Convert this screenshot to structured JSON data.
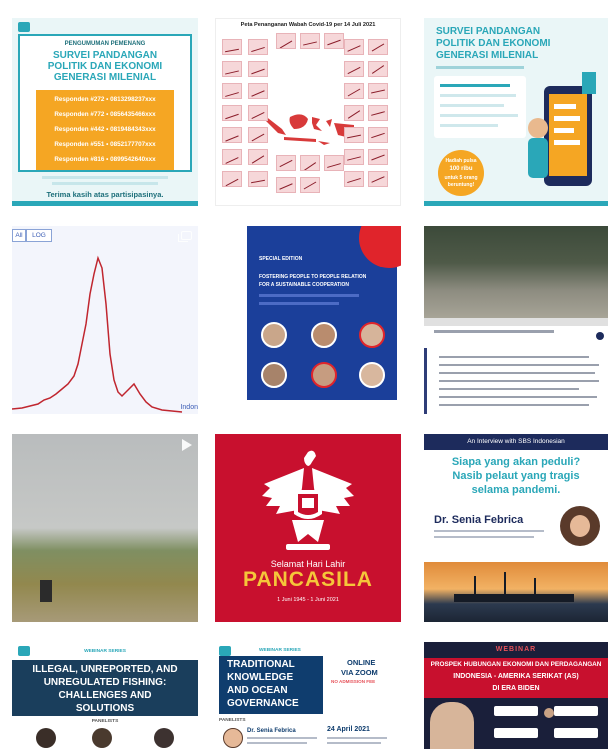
{
  "colors": {
    "teal": "#2aa7b8",
    "orange": "#f5a623",
    "navy": "#1d2b5c",
    "red": "#c8102e",
    "darkblue": "#0f3d6e",
    "blue": "#1b3f9a"
  },
  "tiles": {
    "survey_winners": {
      "heading": "PENGUMUMAN PEMENANG",
      "title": [
        "SURVEI PANDANGAN",
        "POLITIK DAN EKONOMI",
        "GENERASI MILENIAL"
      ],
      "responders": [
        "Responden #272 • 0813298237xxx",
        "Responden #772 • 0856435466xxx",
        "Responden #442 • 0819484343xxx",
        "Responden #551 • 0852177707xxx",
        "Responden #816 • 0899542640xxx"
      ],
      "thanks": "Terima kasih atas partisipasinya."
    },
    "covid_map": {
      "title": "Peta Penanganan Wabah Covid-19 per 14 Juli 2021"
    },
    "survey_invite": {
      "title": [
        "SURVEI PANDANGAN",
        "POLITIK DAN EKONOMI",
        "GENERASI MILENIAL"
      ],
      "badge": [
        "Hadiah pulsa",
        "100 ribu",
        "untuk 5 orang",
        "beruntung!"
      ]
    },
    "log_chart": {
      "toggle_left": "All",
      "toggle_right": "LOG",
      "legend": "Indon"
    },
    "special_edition": {
      "lines": [
        "SPECIAL EDITION",
        "FOSTERING PEOPLE TO PEOPLE RELATION",
        "FOR A SUSTAINABLE COOPERATION"
      ]
    },
    "pancasila": {
      "subtitle": "Selamat Hari Lahir",
      "title": "PANCASILA",
      "date": "1 Juni 1945 - 1 Juni 2021"
    },
    "seafarers": {
      "header": "An Interview with SBS Indonesian",
      "question": [
        "Siapa yang akan peduli?",
        "Nasib pelaut yang tragis",
        "selama pandemi."
      ],
      "speaker": "Dr. Senia Febrica"
    },
    "iuu_fishing": {
      "label": "WEBINAR SERIES",
      "title": [
        "ILLEGAL, UNREPORTED, AND",
        "UNREGULATED FISHING:",
        "CHALLENGES AND",
        "SOLUTIONS"
      ],
      "panelists": "PANELISTS"
    },
    "traditional": {
      "label": "WEBINAR SERIES",
      "title": [
        "TRADITIONAL",
        "KNOWLEDGE",
        "AND OCEAN",
        "GOVERNANCE"
      ],
      "online": [
        "ONLINE",
        "VIA ZOOM",
        "NO ADMISSION FEE"
      ],
      "panelists": "PANELISTS",
      "speaker": "Dr. Senia Febrica",
      "date": "24 April 2021"
    },
    "prospek": {
      "label": "WEBINAR",
      "title": [
        "PROSPEK HUBUNGAN EKONOMI DAN PERDAGANGAN",
        "INDONESIA - AMERIKA SERIKAT (AS)",
        "DI ERA BIDEN"
      ]
    }
  }
}
